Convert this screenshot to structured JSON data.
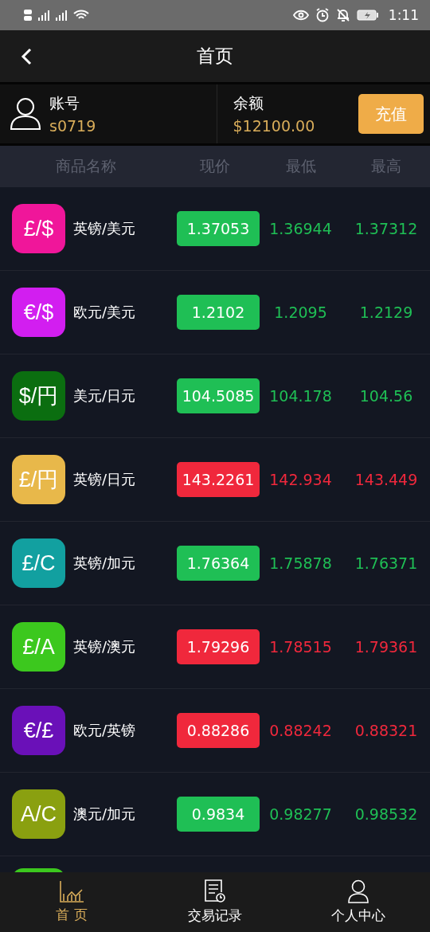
{
  "status_bar": {
    "time": "1:11"
  },
  "header": {
    "title": "首页"
  },
  "account": {
    "label": "账号",
    "value": "s0719",
    "balance_label": "余额",
    "balance": "$12100.00",
    "button": "充值"
  },
  "table": {
    "columns": [
      "商品名称",
      "现价",
      "最低",
      "最高"
    ],
    "rows": [
      {
        "symbol": "£/$",
        "name": "英镑/美元",
        "price": "1.37053",
        "low": "1.36944",
        "high": "1.37312",
        "kind": "up",
        "color": "#f0169a"
      },
      {
        "symbol": "€/$",
        "name": "欧元/美元",
        "price": "1.2102",
        "low": "1.2095",
        "high": "1.2129",
        "kind": "up",
        "color": "#d21ef0"
      },
      {
        "symbol": "$/円",
        "name": "美元/日元",
        "price": "104.5085",
        "low": "104.178",
        "high": "104.56",
        "kind": "up",
        "color": "#0b6e10"
      },
      {
        "symbol": "£/円",
        "name": "英镑/日元",
        "price": "143.2261",
        "low": "142.934",
        "high": "143.449",
        "kind": "down",
        "color": "#e8b84a"
      },
      {
        "symbol": "£/C",
        "name": "英镑/加元",
        "price": "1.76364",
        "low": "1.75878",
        "high": "1.76371",
        "kind": "up",
        "color": "#12a0a0"
      },
      {
        "symbol": "£/A",
        "name": "英镑/澳元",
        "price": "1.79296",
        "low": "1.78515",
        "high": "1.79361",
        "kind": "down",
        "color": "#3cc81e"
      },
      {
        "symbol": "€/£",
        "name": "欧元/英镑",
        "price": "0.88286",
        "low": "0.88242",
        "high": "0.88321",
        "kind": "down",
        "color": "#6a10b8"
      },
      {
        "symbol": "A/C",
        "name": "澳元/加元",
        "price": "0.9834",
        "low": "0.98277",
        "high": "0.98532",
        "kind": "up",
        "color": "#8aa010"
      }
    ],
    "clipped_icon": {
      "color": "#3cc81e"
    }
  },
  "tabs": [
    {
      "label": "首 页",
      "selected": true,
      "kind": "chart"
    },
    {
      "label": "交易记录",
      "selected": false,
      "kind": "record"
    },
    {
      "label": "个人中心",
      "selected": false,
      "kind": "person"
    }
  ]
}
